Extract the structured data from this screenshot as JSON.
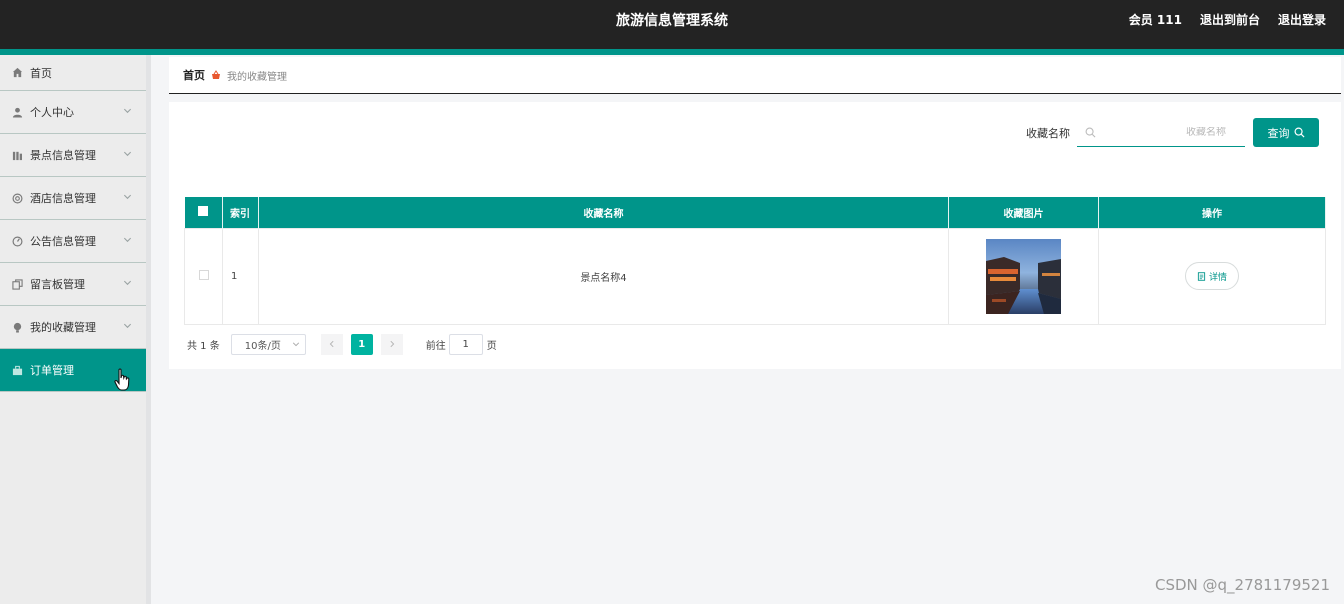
{
  "header": {
    "title": "旅游信息管理系统",
    "member": "会员 111",
    "back_front": "退出到前台",
    "logout": "退出登录"
  },
  "colors": {
    "accent": "#00958a",
    "topbar": "#232323",
    "page_active": "#00b3a0"
  },
  "sidebar": {
    "items": [
      {
        "label": "首页",
        "icon": "home-icon",
        "expandable": false,
        "active": false
      },
      {
        "label": "个人中心",
        "icon": "user-icon",
        "expandable": true,
        "active": false
      },
      {
        "label": "景点信息管理",
        "icon": "bars-icon",
        "expandable": true,
        "active": false
      },
      {
        "label": "酒店信息管理",
        "icon": "circle-icon",
        "expandable": true,
        "active": false
      },
      {
        "label": "公告信息管理",
        "icon": "gauge-icon",
        "expandable": true,
        "active": false
      },
      {
        "label": "留言板管理",
        "icon": "copy-icon",
        "expandable": true,
        "active": false
      },
      {
        "label": "我的收藏管理",
        "icon": "bulb-icon",
        "expandable": true,
        "active": false
      },
      {
        "label": "订单管理",
        "icon": "cart-icon",
        "expandable": false,
        "active": true
      }
    ]
  },
  "breadcrumb": {
    "home": "首页",
    "current": "我的收藏管理"
  },
  "search": {
    "label": "收藏名称",
    "placeholder": "收藏名称",
    "value": "",
    "button": "查询"
  },
  "table": {
    "headers": {
      "index": "索引",
      "name": "收藏名称",
      "image": "收藏图片",
      "action": "操作"
    },
    "rows": [
      {
        "index": "1",
        "name": "景点名称4",
        "action": "详情"
      }
    ]
  },
  "pagination": {
    "total": "共 1 条",
    "page_size": "10条/页",
    "current_page": "1",
    "goto_label": "前往",
    "goto_value": "1",
    "goto_unit": "页"
  },
  "watermark": "CSDN @q_2781179521"
}
